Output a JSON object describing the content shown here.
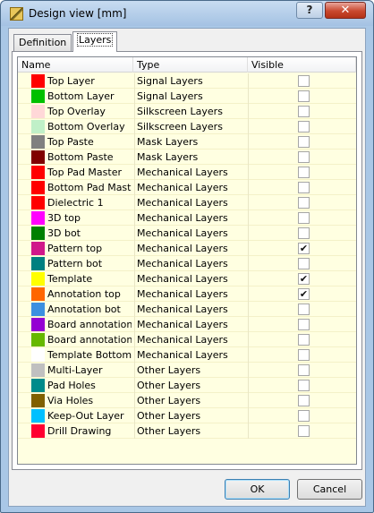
{
  "window": {
    "title": "Design view [mm]",
    "help_label": "?",
    "close_label": "✕"
  },
  "tabs": [
    {
      "label": "Definition",
      "active": false
    },
    {
      "label": "Layers",
      "active": true
    }
  ],
  "grid": {
    "columns": {
      "name": "Name",
      "type": "Type",
      "visible": "Visible"
    },
    "rows": [
      {
        "color": "#ff0000",
        "name": "Top Layer",
        "type": "Signal Layers",
        "visible": false
      },
      {
        "color": "#00c000",
        "name": "Bottom Layer",
        "type": "Signal Layers",
        "visible": false
      },
      {
        "color": "#ffd8d8",
        "name": "Top Overlay",
        "type": "Silkscreen Layers",
        "visible": false
      },
      {
        "color": "#c0f0c8",
        "name": "Bottom Overlay",
        "type": "Silkscreen Layers",
        "visible": false
      },
      {
        "color": "#808080",
        "name": "Top Paste",
        "type": "Mask Layers",
        "visible": false
      },
      {
        "color": "#800000",
        "name": "Bottom Paste",
        "type": "Mask Layers",
        "visible": false
      },
      {
        "color": "#ff0000",
        "name": "Top Pad Master",
        "type": "Mechanical Layers",
        "visible": false
      },
      {
        "color": "#ff0000",
        "name": "Bottom Pad Master",
        "type": "Mechanical Layers",
        "visible": false
      },
      {
        "color": "#ff0000",
        "name": "Dielectric 1",
        "type": "Mechanical Layers",
        "visible": false
      },
      {
        "color": "#ff00ff",
        "name": "3D top",
        "type": "Mechanical Layers",
        "visible": false
      },
      {
        "color": "#008000",
        "name": "3D bot",
        "type": "Mechanical Layers",
        "visible": false
      },
      {
        "color": "#d0188a",
        "name": "Pattern top",
        "type": "Mechanical Layers",
        "visible": true
      },
      {
        "color": "#008080",
        "name": "Pattern bot",
        "type": "Mechanical Layers",
        "visible": false
      },
      {
        "color": "#ffff00",
        "name": "Template",
        "type": "Mechanical Layers",
        "visible": true
      },
      {
        "color": "#ff6600",
        "name": "Annotation top",
        "type": "Mechanical Layers",
        "visible": true
      },
      {
        "color": "#3c8fe0",
        "name": "Annotation bot",
        "type": "Mechanical Layers",
        "visible": false
      },
      {
        "color": "#9400d3",
        "name": "Board annotation",
        "type": "Mechanical Layers",
        "visible": false
      },
      {
        "color": "#66b800",
        "name": "Board annotation",
        "type": "Mechanical Layers",
        "visible": false
      },
      {
        "color": "#ffffff",
        "name": "Template Bottom",
        "type": "Mechanical Layers",
        "visible": false
      },
      {
        "color": "#c0c0c0",
        "name": "Multi-Layer",
        "type": "Other Layers",
        "visible": false
      },
      {
        "color": "#008b8b",
        "name": "Pad Holes",
        "type": "Other Layers",
        "visible": false
      },
      {
        "color": "#806000",
        "name": "Via Holes",
        "type": "Other Layers",
        "visible": false
      },
      {
        "color": "#00c0ff",
        "name": "Keep-Out Layer",
        "type": "Other Layers",
        "visible": false
      },
      {
        "color": "#ff0030",
        "name": "Drill Drawing",
        "type": "Other Layers",
        "visible": false
      }
    ]
  },
  "buttons": {
    "ok": "OK",
    "cancel": "Cancel"
  }
}
